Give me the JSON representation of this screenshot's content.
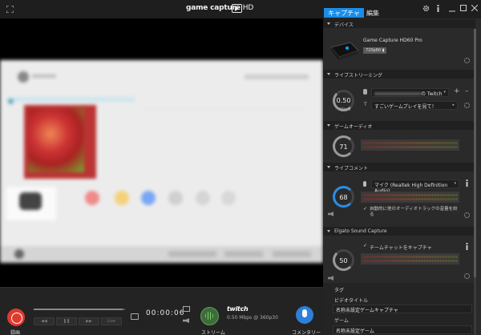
{
  "header": {
    "app_title_main": "game capture",
    "app_title_suffix": "HD",
    "tabs": [
      {
        "label": "キャプチャ"
      },
      {
        "label": "編集"
      }
    ],
    "icons": [
      "expand-icon",
      "logo-icon",
      "settings-gear-icon",
      "info-icon",
      "minimize-icon",
      "maximize-icon",
      "close-icon"
    ]
  },
  "preview": {
    "content": "blurred-game-menu-screenshot"
  },
  "controls": {
    "record_label": "録画",
    "live_label": "Live",
    "timecode": "00:00:06",
    "stream_label": "ストリーム",
    "twitch_logo": "twitch",
    "stream_info": "0.50 Mbps @ 360p30",
    "commentary_label": "コメンタリー",
    "timeline_progress": 0.97
  },
  "panel": {
    "device": {
      "section_title": "デバイス",
      "device_name": "Game Capture HD60 Pro",
      "resolution_badge": "720p60"
    },
    "live_streaming": {
      "section_title": "ライブストリーミング",
      "bitrate_value": "0.50",
      "bitrate_unit": "Mbps",
      "account_suffix": "の Twitch",
      "title_value": "すごいゲームプレイを見て！",
      "bitrate_level": 0.08
    },
    "game_audio": {
      "section_title": "ゲームオーディオ",
      "volume_value": "71",
      "volume_level": 0.71
    },
    "live_commentary": {
      "section_title": "ライブコメント",
      "mic_name": "マイク (Realtek High Definition Audio)",
      "auto_adjust_label": "自動的に他のオーディオトラックの音量を絞る",
      "volume_value": "68",
      "volume_level": 0.68
    },
    "sound_capture": {
      "section_title": "Elgato Sound Capture",
      "chat_capture_label": "チームチャットをキャプチャ",
      "volume_value": "50",
      "volume_level": 0.5
    },
    "tags_label": "タグ",
    "video_title_label": "ビデオタイトル",
    "video_title_value": "名称未設定ゲームキャプチャ",
    "game_label": "ゲーム",
    "game_value": "名称未設定ゲーム"
  },
  "colors": {
    "accent_blue": "#1a8de8",
    "record_red": "#e03a2f",
    "stream_green": "#58a14e",
    "commentary_blue": "#2e7fd9",
    "knob_arc": "#9a9a9a",
    "commentary_knob_arc": "#2a8de8"
  }
}
